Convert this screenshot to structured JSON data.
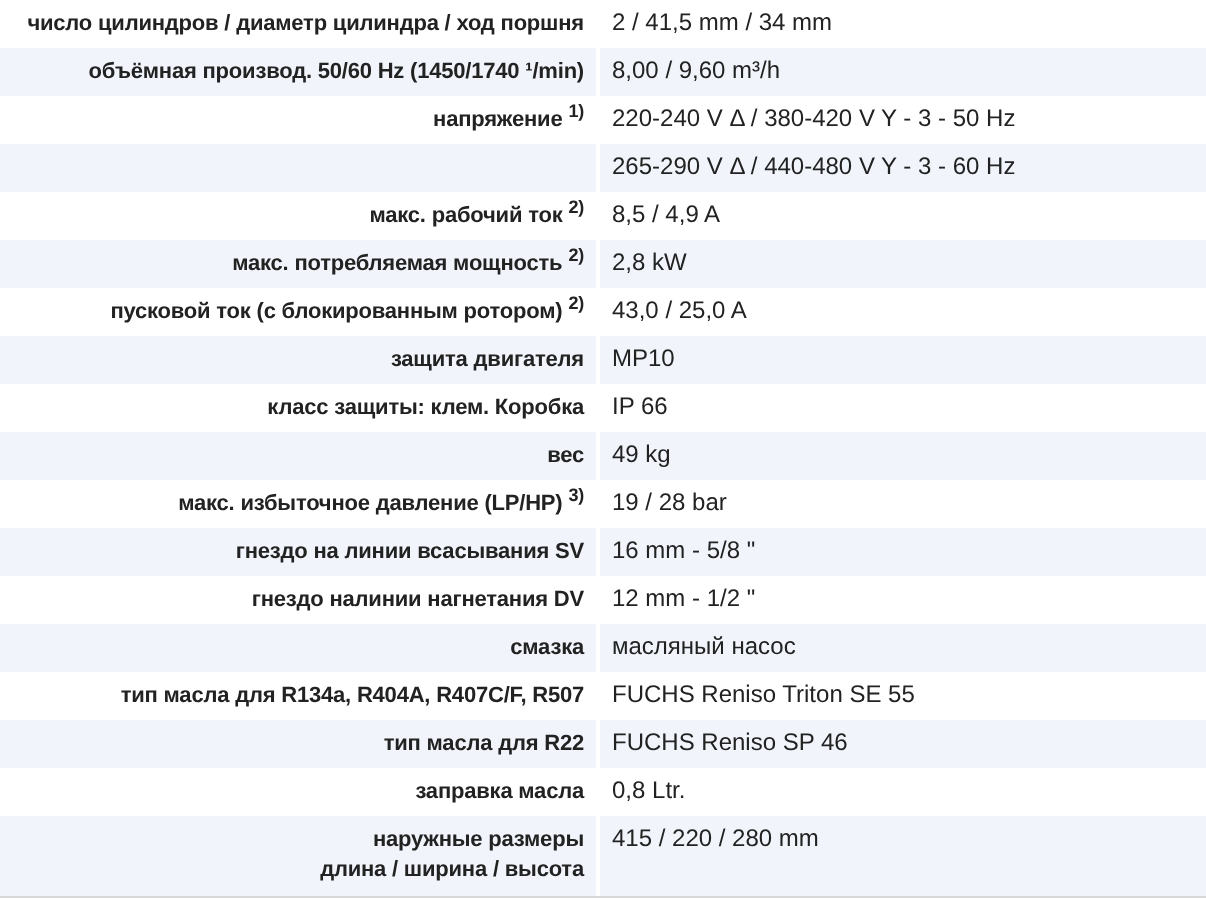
{
  "rows": [
    {
      "label": "число цилиндров / диаметр цилиндра / ход поршня",
      "value": "2 / 41,5 mm / 34 mm"
    },
    {
      "label": "объёмная производ. 50/60 Hz (1450/1740 ¹/min)",
      "value": "8,00 / 9,60 m³/h"
    },
    {
      "label": "напряжение $^{1)}$",
      "value": "220-240 V Δ / 380-420 V Y - 3 - 50 Hz"
    },
    {
      "value": "265-290 V Δ / 440-480 V Y - 3 - 60 Hz"
    },
    {
      "label": "макс. рабочий ток $^{2)}$",
      "value": "8,5 / 4,9 A"
    },
    {
      "label": "макс. потребляемая мощность $^{2)}$",
      "value": "2,8 kW"
    },
    {
      "label": "пусковой ток (с блокированным ротором) $^{2)}$",
      "value": "43,0 / 25,0 A"
    },
    {
      "label": "защита двигателя",
      "value": "MP10"
    },
    {
      "label": "класс защиты: клем. Коробка",
      "value": "IP 66"
    },
    {
      "label": "вес",
      "value": "49 kg"
    },
    {
      "label": "макс. избыточное давление (LP/HP) $^{3)}$",
      "value": "19 / 28 bar"
    },
    {
      "label": "гнездо на линии всасывания SV",
      "value": "16 mm - 5/8 \""
    },
    {
      "label": "гнездо налинии нагнетания DV",
      "value": "12 mm - 1/2 \""
    },
    {
      "label": "смазка",
      "value": "масляный насос"
    },
    {
      "label": "тип масла для R134a, R404A, R407C/F, R507",
      "value": "FUCHS Reniso Triton SE 55"
    },
    {
      "label": "тип масла для R22",
      "value": "FUCHS Reniso SP 46"
    },
    {
      "label": "заправка масла",
      "value": "0,8 Ltr."
    },
    {
      "label": "наружные размеры\nдлина / ширина / высота",
      "value": "415 / 220 / 280 mm"
    }
  ]
}
